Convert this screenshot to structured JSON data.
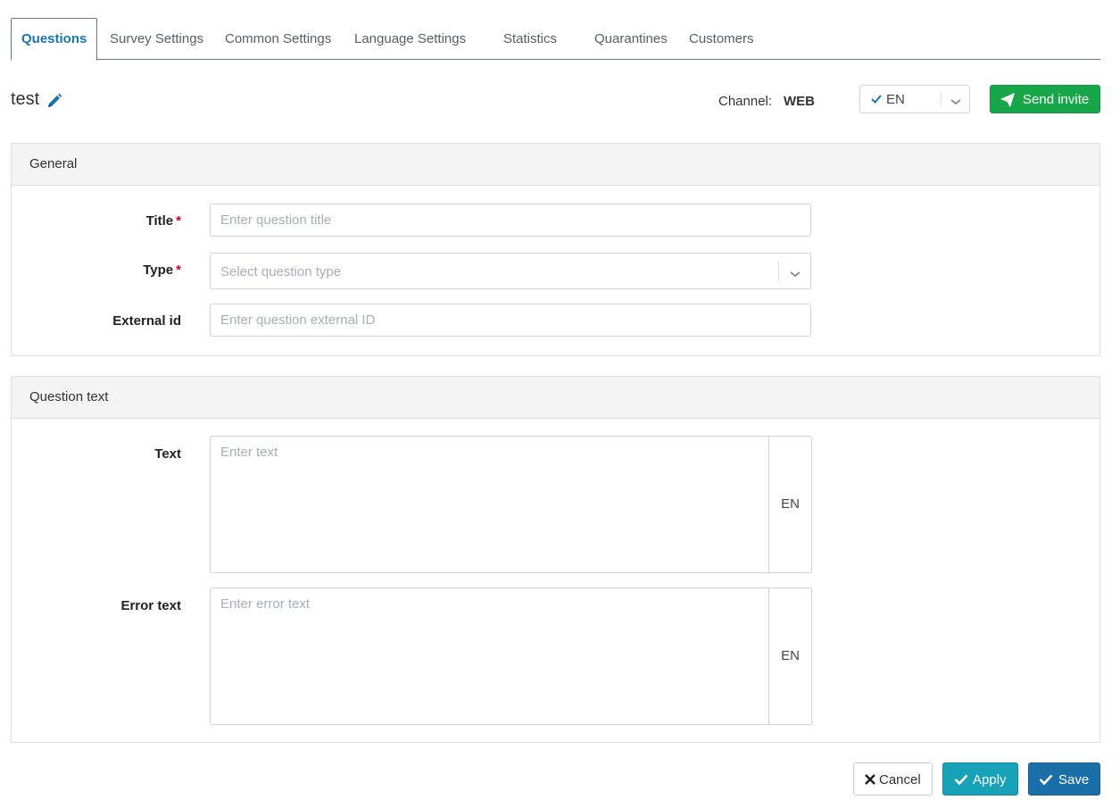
{
  "tabs": [
    {
      "label": "Questions",
      "active": true
    },
    {
      "label": "Survey Settings",
      "active": false
    },
    {
      "label": "Common Settings",
      "active": false
    },
    {
      "label": "Language Settings",
      "active": false
    },
    {
      "label": "Statistics",
      "active": false
    },
    {
      "label": "Quarantines",
      "active": false
    },
    {
      "label": "Customers",
      "active": false
    }
  ],
  "header": {
    "title": "test",
    "edit_icon": "pencil-icon",
    "channel_label": "Channel:",
    "channel_value": "WEB",
    "language_value": "EN",
    "send_invite_label": "Send invite"
  },
  "general": {
    "heading": "General",
    "title_label": "Title",
    "title_placeholder": "Enter question title",
    "type_label": "Type",
    "type_placeholder": "Select question type",
    "external_id_label": "External id",
    "external_id_placeholder": "Enter question external ID",
    "required_marker": "*"
  },
  "question_text": {
    "heading": "Question text",
    "text_label": "Text",
    "text_placeholder": "Enter text",
    "text_lang": "EN",
    "error_label": "Error text",
    "error_placeholder": "Enter error text",
    "error_lang": "EN"
  },
  "footer": {
    "cancel_label": "Cancel",
    "apply_label": "Apply",
    "save_label": "Save"
  },
  "colors": {
    "active_tab": "#1a74b0",
    "send_invite": "#17a74a",
    "apply": "#17a2b8",
    "save": "#1b6fa8",
    "required": "#d0021b"
  }
}
